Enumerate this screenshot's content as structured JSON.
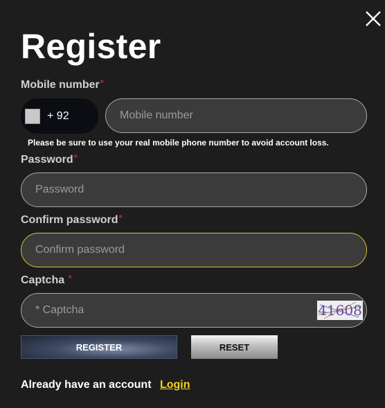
{
  "modal": {
    "title": "Register",
    "close_icon": "close-icon"
  },
  "mobile": {
    "label": "Mobile number",
    "required_mark": "*",
    "country_code": "+ 92",
    "flag_icon": "flag-icon",
    "placeholder": "Mobile number",
    "value": "",
    "hint": "Please be sure to use your real mobile phone number to avoid account loss."
  },
  "password": {
    "label": "Password",
    "required_mark": "*",
    "placeholder": "Password",
    "value": ""
  },
  "confirm_password": {
    "label": "Confirm password",
    "required_mark": "*",
    "placeholder": "Confirm password",
    "value": ""
  },
  "captcha": {
    "label": "Captcha",
    "required_mark": "*",
    "placeholder": "* Captcha",
    "value": "",
    "image_text": "41608"
  },
  "buttons": {
    "register_label": "REGISTER",
    "reset_label": "RESET"
  },
  "footer": {
    "question": "Already have an account",
    "login_link": "Login"
  },
  "colors": {
    "background": "#1d1d1e",
    "input_background": "#3b3b3b",
    "focus_border": "#d8c32a",
    "required": "#c0232b",
    "login_link": "#f4d21a"
  }
}
